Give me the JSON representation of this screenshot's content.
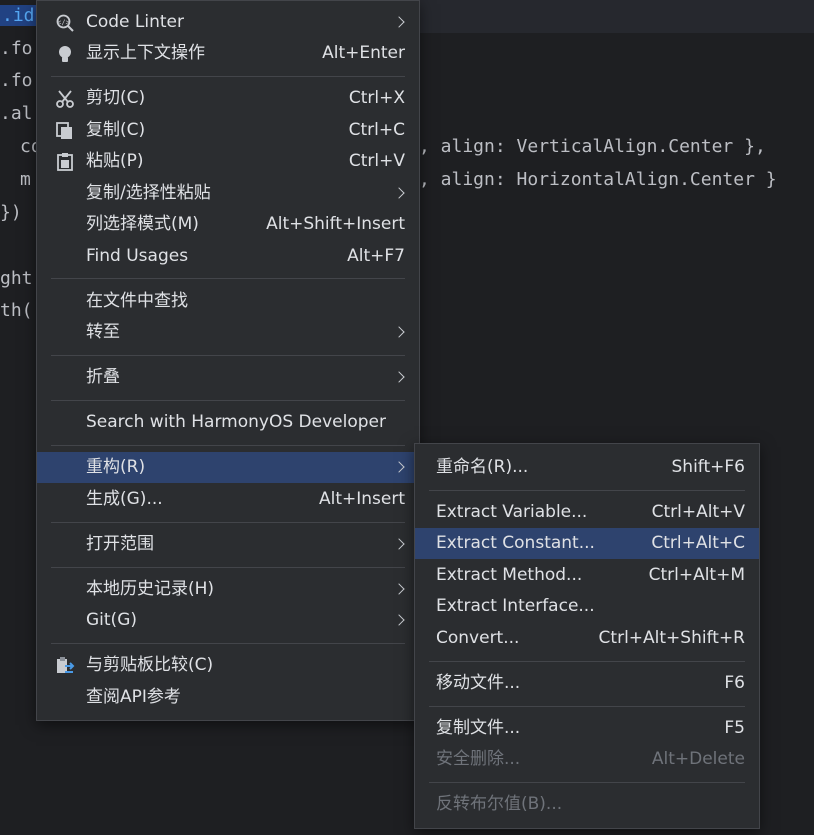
{
  "editor": {
    "lines": [
      {
        "id": "l1",
        "text": ".id"
      },
      {
        "id": "l2",
        "text": ".fo"
      },
      {
        "id": "l3",
        "text": ".fo"
      },
      {
        "id": "l4",
        "text": ".al"
      },
      {
        "id": "l5a",
        "text": "co"
      },
      {
        "id": "l5b",
        "text": ", align: VerticalAlign.Center },"
      },
      {
        "id": "l6a",
        "text": "m"
      },
      {
        "id": "l6b",
        "text": ", align: HorizontalAlign.Center }"
      },
      {
        "id": "l7",
        "text": "})"
      },
      {
        "id": "l8",
        "text": "ght"
      },
      {
        "id": "l9",
        "text": "th("
      }
    ]
  },
  "main_menu": {
    "items": [
      {
        "label": "Code Linter",
        "shortcut": "",
        "submenu": true,
        "icon": "code-linter-icon"
      },
      {
        "label": "显示上下文操作",
        "shortcut": "Alt+Enter",
        "submenu": false,
        "icon": "lightbulb-icon"
      },
      {
        "label": "剪切(C)",
        "shortcut": "Ctrl+X",
        "submenu": false,
        "icon": "scissors-icon"
      },
      {
        "label": "复制(C)",
        "shortcut": "Ctrl+C",
        "submenu": false,
        "icon": "copy-icon"
      },
      {
        "label": "粘贴(P)",
        "shortcut": "Ctrl+V",
        "submenu": false,
        "icon": "paste-icon"
      },
      {
        "label": "复制/选择性粘贴",
        "shortcut": "",
        "submenu": true,
        "icon": ""
      },
      {
        "label": "列选择模式(M)",
        "shortcut": "Alt+Shift+Insert",
        "submenu": false,
        "icon": ""
      },
      {
        "label": "Find Usages",
        "shortcut": "Alt+F7",
        "submenu": false,
        "icon": ""
      },
      {
        "label": "在文件中查找",
        "shortcut": "",
        "submenu": false,
        "icon": ""
      },
      {
        "label": "转至",
        "shortcut": "",
        "submenu": true,
        "icon": ""
      },
      {
        "label": "折叠",
        "shortcut": "",
        "submenu": true,
        "icon": ""
      },
      {
        "label": "Search with HarmonyOS Developer",
        "shortcut": "",
        "submenu": false,
        "icon": ""
      },
      {
        "label": "重构(R)",
        "shortcut": "",
        "submenu": true,
        "icon": ""
      },
      {
        "label": "生成(G)...",
        "shortcut": "Alt+Insert",
        "submenu": false,
        "icon": ""
      },
      {
        "label": "打开范围",
        "shortcut": "",
        "submenu": true,
        "icon": ""
      },
      {
        "label": "本地历史记录(H)",
        "shortcut": "",
        "submenu": true,
        "icon": ""
      },
      {
        "label": "Git(G)",
        "shortcut": "",
        "submenu": true,
        "icon": ""
      },
      {
        "label": "与剪贴板比较(C)",
        "shortcut": "",
        "submenu": false,
        "icon": "compare-clipboard-icon"
      },
      {
        "label": "查阅API参考",
        "shortcut": "",
        "submenu": false,
        "icon": ""
      }
    ]
  },
  "sub_menu": {
    "items": [
      {
        "label": "重命名(R)...",
        "shortcut": "Shift+F6",
        "disabled": false
      },
      {
        "label": "Extract Variable...",
        "shortcut": "Ctrl+Alt+V",
        "disabled": false
      },
      {
        "label": "Extract Constant...",
        "shortcut": "Ctrl+Alt+C",
        "disabled": false
      },
      {
        "label": "Extract Method...",
        "shortcut": "Ctrl+Alt+M",
        "disabled": false
      },
      {
        "label": "Extract Interface...",
        "shortcut": "",
        "disabled": false
      },
      {
        "label": "Convert...",
        "shortcut": "Ctrl+Alt+Shift+R",
        "disabled": false
      },
      {
        "label": "移动文件...",
        "shortcut": "F6",
        "disabled": false
      },
      {
        "label": "复制文件...",
        "shortcut": "F5",
        "disabled": false
      },
      {
        "label": "安全删除...",
        "shortcut": "Alt+Delete",
        "disabled": true
      },
      {
        "label": "反转布尔值(B)...",
        "shortcut": "",
        "disabled": true
      }
    ]
  },
  "colors": {
    "menu_bg": "#2b2d30",
    "highlight": "#2e436e",
    "editor_bg": "#1e1f22",
    "disabled_text": "#6f737a"
  }
}
